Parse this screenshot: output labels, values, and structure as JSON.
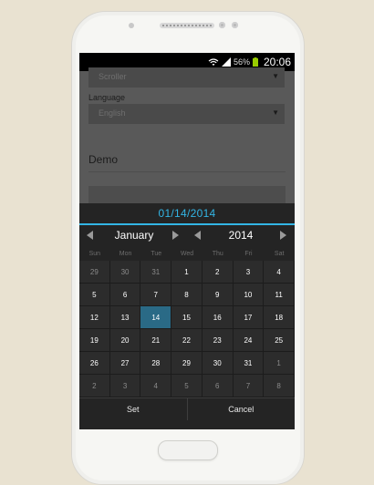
{
  "status": {
    "battery": "56%",
    "time": "20:06"
  },
  "background": {
    "mode_value": "Scroller",
    "language_label": "Language",
    "language_value": "English",
    "demo_label": "Demo"
  },
  "picker": {
    "title": "01/14/2014",
    "month": "January",
    "year": "2014",
    "weekdays": [
      "Sun",
      "Mon",
      "Tue",
      "Wed",
      "Thu",
      "Fri",
      "Sat"
    ],
    "days": [
      {
        "d": "29",
        "other": true
      },
      {
        "d": "30",
        "other": true
      },
      {
        "d": "31",
        "other": true
      },
      {
        "d": "1"
      },
      {
        "d": "2"
      },
      {
        "d": "3"
      },
      {
        "d": "4"
      },
      {
        "d": "5"
      },
      {
        "d": "6"
      },
      {
        "d": "7"
      },
      {
        "d": "8"
      },
      {
        "d": "9"
      },
      {
        "d": "10"
      },
      {
        "d": "11"
      },
      {
        "d": "12"
      },
      {
        "d": "13"
      },
      {
        "d": "14",
        "selected": true
      },
      {
        "d": "15"
      },
      {
        "d": "16"
      },
      {
        "d": "17"
      },
      {
        "d": "18"
      },
      {
        "d": "19"
      },
      {
        "d": "20"
      },
      {
        "d": "21"
      },
      {
        "d": "22"
      },
      {
        "d": "23"
      },
      {
        "d": "24"
      },
      {
        "d": "25"
      },
      {
        "d": "26"
      },
      {
        "d": "27"
      },
      {
        "d": "28"
      },
      {
        "d": "29"
      },
      {
        "d": "30"
      },
      {
        "d": "31"
      },
      {
        "d": "1",
        "other": true
      },
      {
        "d": "2",
        "other": true
      },
      {
        "d": "3",
        "other": true
      },
      {
        "d": "4",
        "other": true
      },
      {
        "d": "5",
        "other": true
      },
      {
        "d": "6",
        "other": true
      },
      {
        "d": "7",
        "other": true
      },
      {
        "d": "8",
        "other": true
      }
    ],
    "set_label": "Set",
    "cancel_label": "Cancel"
  },
  "colors": {
    "accent": "#33b5e5",
    "selected_day": "#2a6a86",
    "background": "#e9e2d1"
  }
}
